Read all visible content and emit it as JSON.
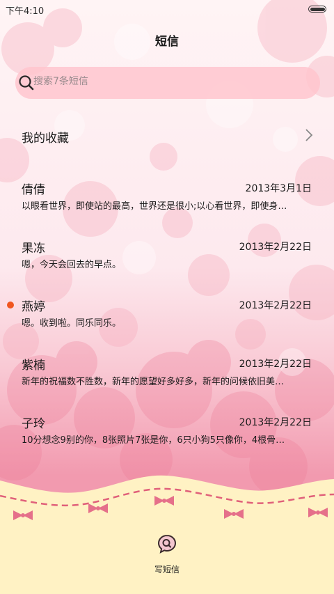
{
  "status_bar": {
    "time": "下午4:10"
  },
  "header": {
    "title": "短信"
  },
  "search": {
    "placeholder": "搜索7条短信",
    "icon": "search-icon"
  },
  "favorites": {
    "label": "我的收藏",
    "icon": "chevron-right-icon"
  },
  "messages": [
    {
      "name": "倩倩",
      "date": "2013年3月1日",
      "preview": "以眼看世界，即使站的最高，世界还是很小;以心看世界，即使身…",
      "unread": false
    },
    {
      "name": "果冻",
      "date": "2013年2月22日",
      "preview": "嗯，今天会回去的早点。",
      "unread": false
    },
    {
      "name": "燕婷",
      "date": "2013年2月22日",
      "preview": "嗯。收到啦。同乐同乐。",
      "unread": true
    },
    {
      "name": "紫楠",
      "date": "2013年2月22日",
      "preview": "新年的祝福数不胜数，新年的愿望好多好多，新年的问候依旧美…",
      "unread": false
    },
    {
      "name": "子玲",
      "date": "2013年2月22日",
      "preview": "10分想念9别的你，8张照片7张是你，6只小狗5只像你，4根骨…",
      "unread": false
    }
  ],
  "compose": {
    "label": "写短信",
    "icon": "compose-message-icon"
  },
  "colors": {
    "unread_dot": "#f0561f",
    "search_bg": "#ffc5ce",
    "ribbon": "#e0607a",
    "bottom_band": "#fff1bf"
  }
}
